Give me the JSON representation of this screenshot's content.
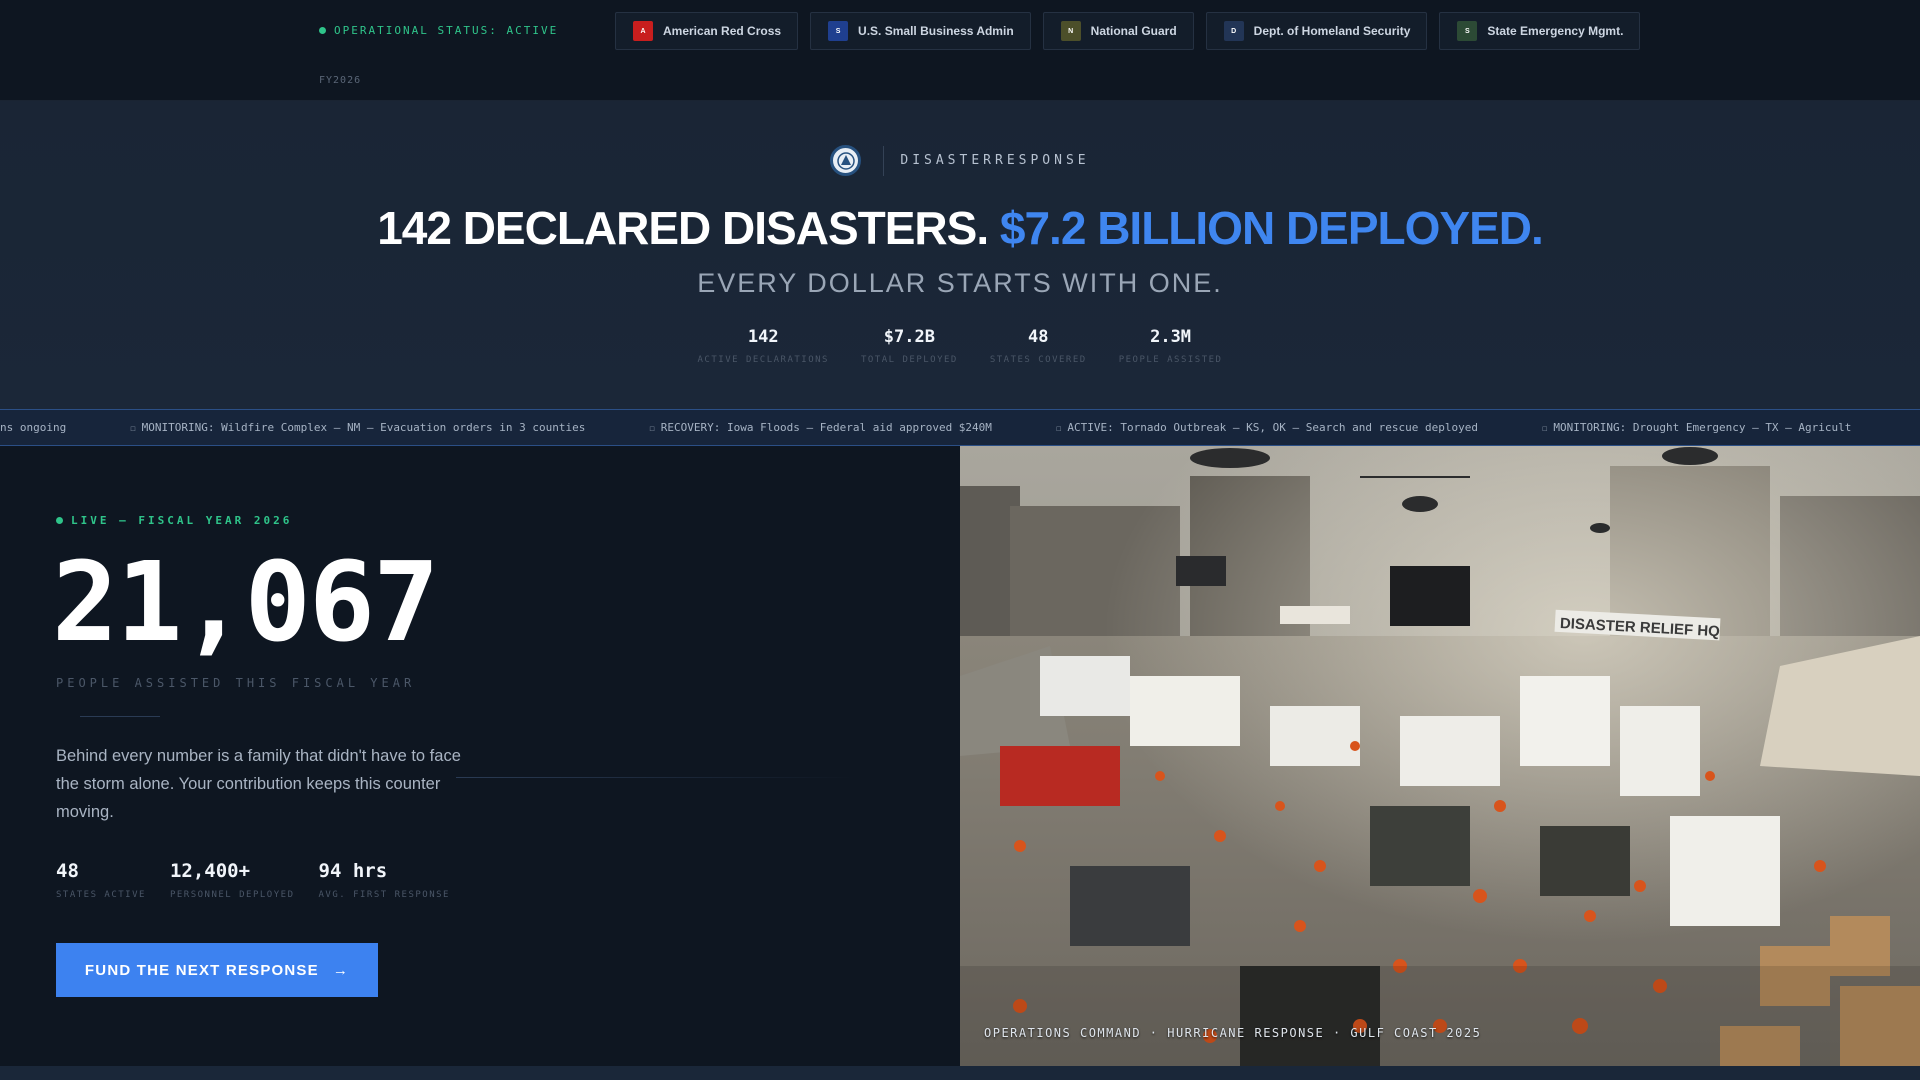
{
  "topbar": {
    "status": "OPERATIONAL STATUS: ACTIVE",
    "fiscal_year": "FY2026",
    "partners": [
      {
        "initial": "A",
        "label": "American Red Cross",
        "color": "#c81e1e"
      },
      {
        "initial": "S",
        "label": "U.S. Small Business Admin",
        "color": "#1f3f8f"
      },
      {
        "initial": "N",
        "label": "National Guard",
        "color": "#4c4f2a"
      },
      {
        "initial": "D",
        "label": "Dept. of Homeland Security",
        "color": "#223556"
      },
      {
        "initial": "S",
        "label": "State Emergency Mgmt.",
        "color": "#2c4a35"
      }
    ]
  },
  "hero": {
    "brand": "DISASTERRESPONSE",
    "headline_white": "142 DECLARED DISASTERS.",
    "headline_blue": "$7.2 BILLION DEPLOYED.",
    "subheadline": "EVERY DOLLAR STARTS WITH ONE.",
    "stats": [
      {
        "value": "142",
        "label": "ACTIVE DECLARATIONS"
      },
      {
        "value": "$7.2B",
        "label": "TOTAL DEPLOYED"
      },
      {
        "value": "48",
        "label": "STATES COVERED"
      },
      {
        "value": "2.3M",
        "label": "PEOPLE ASSISTED"
      }
    ]
  },
  "ticker": [
    "ns ongoing",
    "MONITORING: Wildfire Complex — NM — Evacuation orders in 3 counties",
    "RECOVERY: Iowa Floods — Federal aid approved $240M",
    "ACTIVE: Tornado Outbreak — KS, OK — Search and rescue deployed",
    "MONITORING: Drought Emergency — TX — Agricult"
  ],
  "main": {
    "live_label": "LIVE — FISCAL YEAR 2026",
    "counter": "21,067",
    "counter_label": "PEOPLE ASSISTED THIS FISCAL YEAR",
    "description": "Behind every number is a family that didn't have to face the storm alone. Your contribution keeps this counter moving.",
    "mini_stats": [
      {
        "value": "48",
        "label": "STATES ACTIVE"
      },
      {
        "value": "12,400+",
        "label": "PERSONNEL DEPLOYED"
      },
      {
        "value": "94 hrs",
        "label": "AVG. FIRST RESPONSE"
      }
    ],
    "cta_label": "FUND THE NEXT RESPONSE",
    "cta_arrow": "→"
  },
  "photo": {
    "caption": "OPERATIONS COMMAND · HURRICANE RESPONSE · GULF COAST 2025",
    "sign_text": "DISASTER RELIEF HQ"
  },
  "colors": {
    "accent": "#3f86f0",
    "status_green": "#2fc48a",
    "background": "#0f1722"
  }
}
